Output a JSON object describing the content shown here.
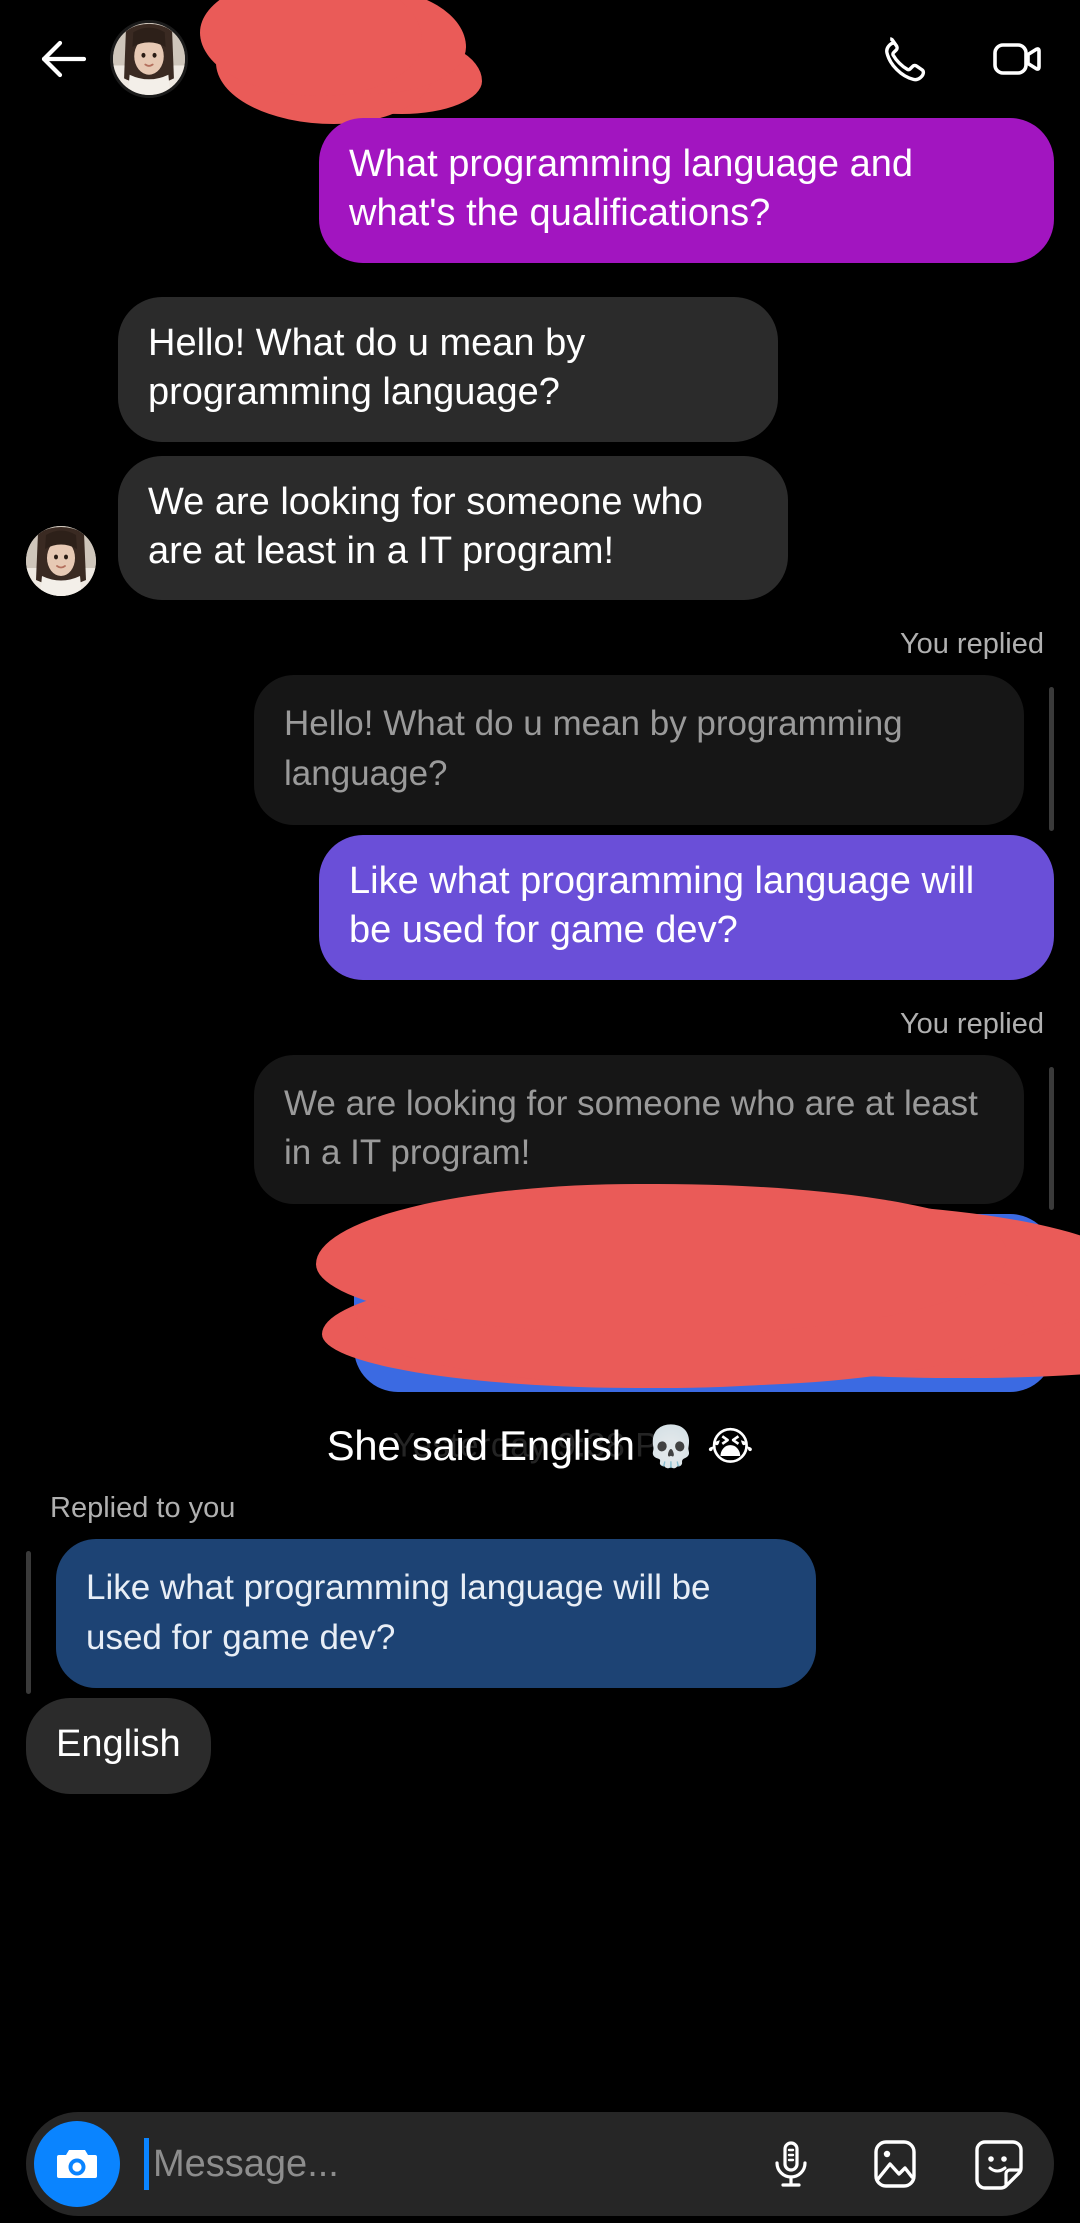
{
  "app": {
    "background_color": "#000000",
    "accent_blue": "#0a84ff"
  },
  "header": {
    "back_icon": "back-arrow-icon",
    "avatar": "contact-avatar",
    "contact_name": "",
    "contact_name_redacted": true,
    "call_icon": "phone-call-icon",
    "video_icon": "video-call-icon"
  },
  "conversation": {
    "messages": [
      {
        "id": "m1",
        "direction": "outgoing",
        "style": "purple",
        "text": "What programming language and what's the qualifications?"
      },
      {
        "id": "m2",
        "direction": "incoming",
        "style": "gray",
        "text": "Hello! What do u mean by programming language?"
      },
      {
        "id": "m3",
        "direction": "incoming",
        "style": "gray",
        "text": "We are looking for someone who are at least in a IT program!"
      },
      {
        "id": "m4",
        "direction": "outgoing",
        "style": "violet",
        "reply_label": "You replied",
        "quoted_text": "Hello! What do u mean by programming language?",
        "text": "Like what programming language will be used for game dev?"
      },
      {
        "id": "m5",
        "direction": "outgoing",
        "style": "blue",
        "reply_label": "You replied",
        "quoted_text": "We are looking for someone who are at least in a IT program!",
        "text": "",
        "redacted": true
      },
      {
        "id": "m6",
        "direction": "incoming",
        "style": "dark-blue-quote",
        "reply_label": "Replied to you",
        "quoted_text": "Like what programming language will be used for game dev?",
        "text": "English"
      }
    ],
    "timestamp": "Yesterday 9:38 PM",
    "caption": "She said English",
    "caption_emoji_skull": "💀",
    "caption_emoji_sob": "😭"
  },
  "composer": {
    "camera_icon": "camera-icon",
    "placeholder": "Message...",
    "value": "",
    "mic_icon": "microphone-icon",
    "gallery_icon": "image-gallery-icon",
    "sticker_icon": "sticker-icon"
  },
  "colors": {
    "bubble_purple": "#a215c0",
    "bubble_violet": "#6a4fd8",
    "bubble_blue": "#3b6ae2",
    "bubble_gray": "#2b2b2b",
    "quote_dark": "#161616",
    "quote_dark_blue": "#1d4374",
    "redaction_red": "#ea5b58"
  }
}
